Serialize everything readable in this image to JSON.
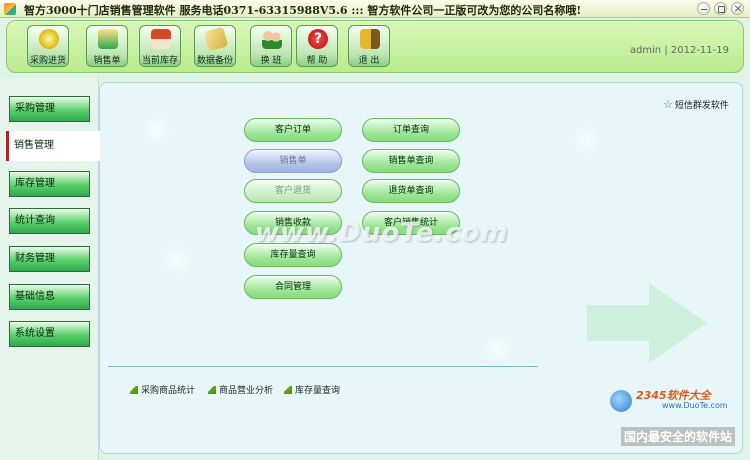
{
  "window": {
    "title": "智方3000十门店销售管理软件   服务电话0371-63315988V5.6 ::: 智方软件公司一正版可改为您的公司名称哦!"
  },
  "toolbar": {
    "buttons": [
      {
        "label": "采购进货",
        "icon": "purchase-icon",
        "color": "#e3c21a"
      },
      {
        "label": "销售单",
        "icon": "sales-order-icon",
        "color": "#2fa84d"
      },
      {
        "label": "当前库存",
        "icon": "inventory-house-icon",
        "color": "#d9472a"
      },
      {
        "label": "数据备份",
        "icon": "backup-icon",
        "color": "#d8b13a"
      },
      {
        "label": "换 班",
        "icon": "shift-change-icon",
        "color": "#2d8a2d"
      },
      {
        "label": "帮 助",
        "icon": "help-icon",
        "color": "#cc1f1f"
      },
      {
        "label": "退 出",
        "icon": "exit-icon",
        "color": "#e6b62c"
      }
    ],
    "user_info": "admin | 2012-11-19"
  },
  "sidebar": {
    "items": [
      {
        "label": "采购管理",
        "active": false
      },
      {
        "label": "销售管理",
        "active": true
      },
      {
        "label": "库存管理",
        "active": false
      },
      {
        "label": "统计查询",
        "active": false
      },
      {
        "label": "财务管理",
        "active": false
      },
      {
        "label": "基础信息",
        "active": false
      },
      {
        "label": "系统设置",
        "active": false
      }
    ]
  },
  "main": {
    "sms_link": "短信群发软件",
    "buttons": [
      {
        "label": "客户订单",
        "state": "normal"
      },
      {
        "label": "订单查询",
        "state": "normal"
      },
      {
        "label": "销售单",
        "state": "hover"
      },
      {
        "label": "销售单查询",
        "state": "normal"
      },
      {
        "label": "客户退货",
        "state": "faded"
      },
      {
        "label": "退货单查询",
        "state": "normal"
      },
      {
        "label": "销售收款",
        "state": "normal"
      },
      {
        "label": "客户销售统计",
        "state": "normal"
      },
      {
        "label": "库存量查询",
        "state": "normal"
      },
      {
        "label": "合同管理",
        "state": "normal"
      }
    ],
    "bottom_links": [
      "采购商品统计",
      "商品营业分析",
      "库存量查询"
    ],
    "watermark": "www.DuoTe.com"
  },
  "branding": {
    "name": "2345软件大全",
    "url": "www.DuoTe.com",
    "slogan": "国内最安全的软件站"
  }
}
